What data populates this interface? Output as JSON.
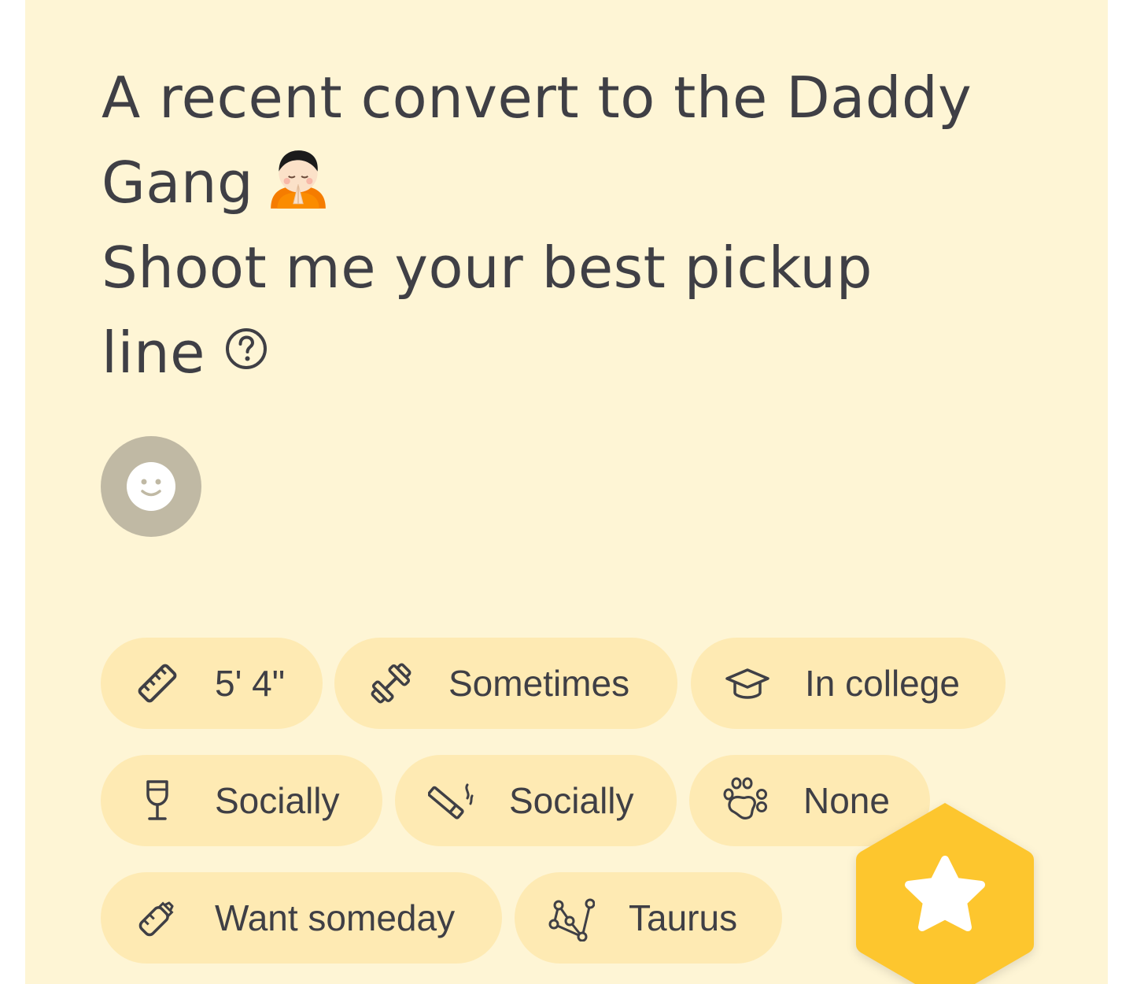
{
  "profile": {
    "bio_line_1": "A recent convert to the Daddy",
    "bio_line_2": "Gang",
    "bio_line_3": "Shoot me your best pickup",
    "bio_line_4": "line",
    "bio_emoji": "person-bowing-emoji",
    "help_icon": "question-circle-icon",
    "avatar_icon": "smiley-face-icon"
  },
  "badges": [
    {
      "icon": "ruler-icon",
      "label": "5' 4\""
    },
    {
      "icon": "dumbbell-icon",
      "label": "Sometimes"
    },
    {
      "icon": "graduation-cap-icon",
      "label": "In college"
    },
    {
      "icon": "wine-glass-icon",
      "label": "Socially"
    },
    {
      "icon": "cigarette-icon",
      "label": "Socially"
    },
    {
      "icon": "paw-icon",
      "label": "None"
    },
    {
      "icon": "baby-bottle-icon",
      "label": "Want someday"
    },
    {
      "icon": "constellation-icon",
      "label": "Taurus"
    }
  ],
  "superswipe": {
    "icon": "star-icon"
  },
  "colors": {
    "card_background": "#fef5d5",
    "badge_background": "#feeab3",
    "text": "#3f3f45",
    "superswipe_yellow": "#fdc62e",
    "avatar_gray": "#c0b9a4"
  }
}
